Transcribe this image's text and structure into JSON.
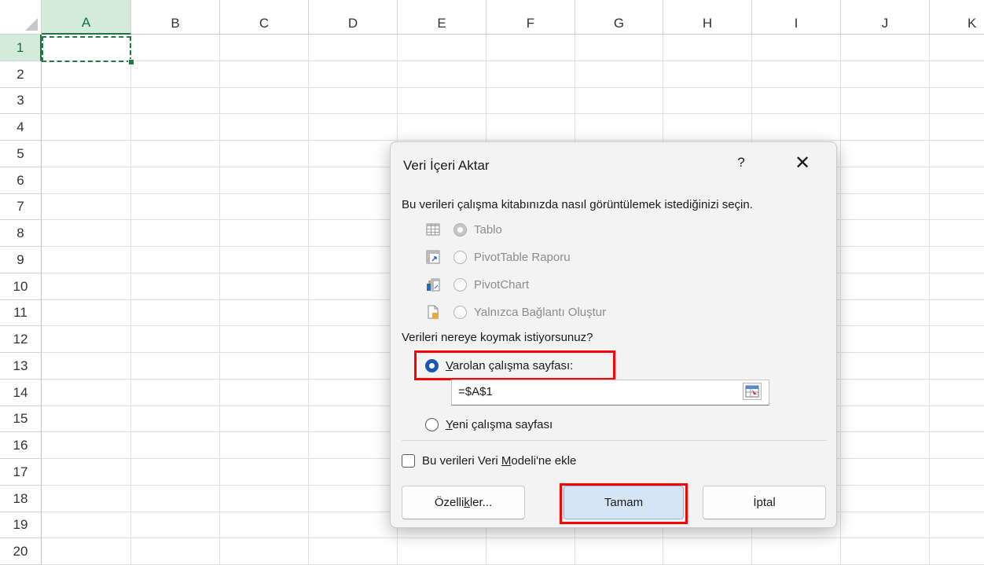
{
  "sheet": {
    "columns": [
      "A",
      "B",
      "C",
      "D",
      "E",
      "F",
      "G",
      "H",
      "I",
      "J",
      "K"
    ],
    "rows": [
      "1",
      "2",
      "3",
      "4",
      "5",
      "6",
      "7",
      "8",
      "9",
      "10",
      "11",
      "12",
      "13",
      "14",
      "15",
      "16",
      "17",
      "18",
      "19",
      "20"
    ],
    "active_column": "A",
    "active_row": "1",
    "accent_color": "#217346"
  },
  "dialog": {
    "title": "Veri İçeri Aktar",
    "help_label": "?",
    "close_label": "✕",
    "view_prompt": "Bu verileri çalışma kitabınızda nasıl görüntülemek istediğinizi seçin.",
    "view_options": [
      {
        "label": "Tablo",
        "icon": "table-icon",
        "selected": true
      },
      {
        "label": "PivotTable Raporu",
        "icon": "pivottable-icon",
        "selected": false
      },
      {
        "label": "PivotChart",
        "icon": "pivotchart-icon",
        "selected": false
      },
      {
        "label": "Yalnızca Bağlantı Oluştur",
        "icon": "connection-only-icon",
        "selected": false
      }
    ],
    "location_prompt": "Verileri nereye koymak istiyorsunuz?",
    "existing_sheet": {
      "mnemonic": "V",
      "rest": "arolan çalışma sayfası:"
    },
    "reference_value": "=$A$1",
    "new_sheet": {
      "mnemonic": "Y",
      "rest": "eni çalışma sayfası"
    },
    "data_model": {
      "before": "Bu verileri Veri ",
      "mnemonic": "M",
      "after": "odeli'ne ekle"
    },
    "buttons": {
      "properties": {
        "before": "Özelli",
        "mnemonic": "k",
        "after": "ler..."
      },
      "ok": "Tamam",
      "cancel": "İptal"
    },
    "highlight_color": "#ff0000"
  }
}
